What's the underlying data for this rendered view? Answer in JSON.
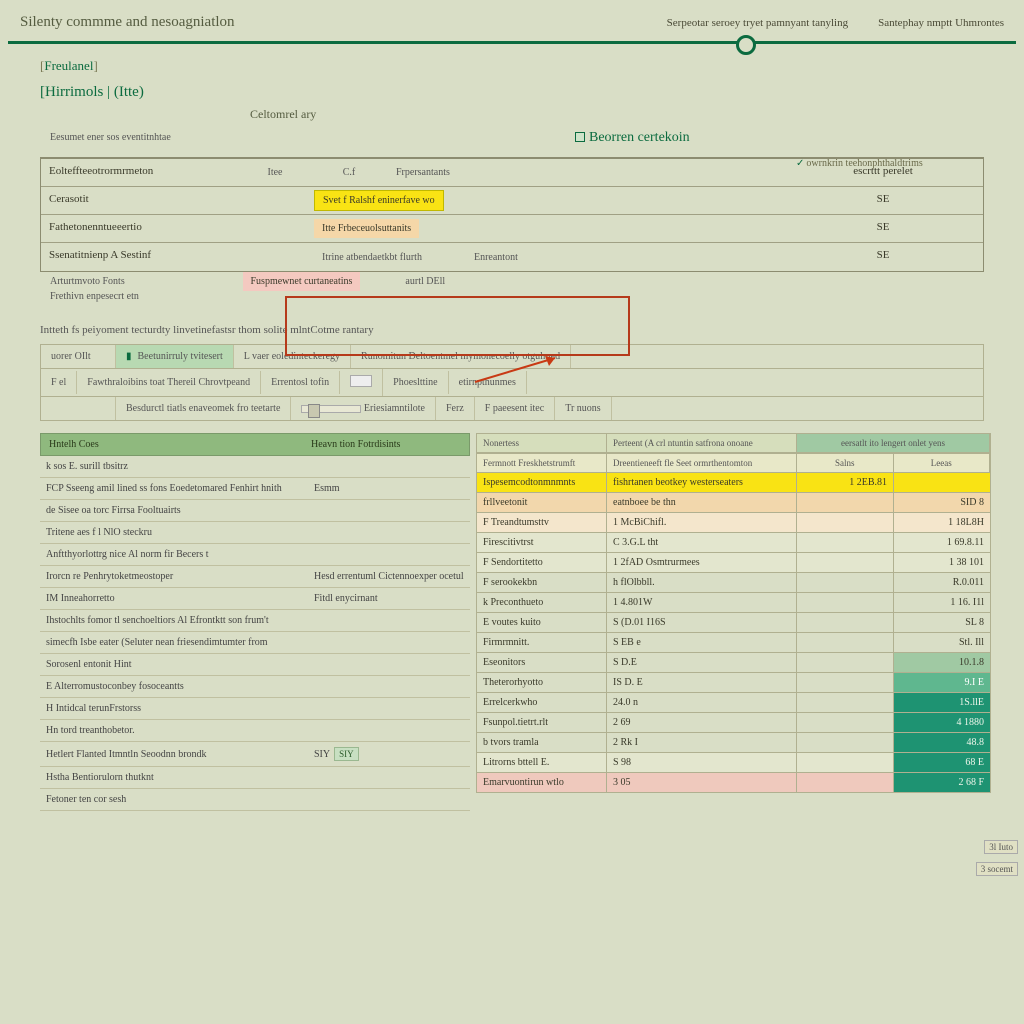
{
  "header": {
    "title": "Silenty commme and nesoagniatlon",
    "right1": "Serpeotar seroey tryet pamnyant tanyling",
    "right2": "Santephay nmptt Uhmrontes"
  },
  "crumbs": {
    "featured": "Freulanel",
    "controls": "Hirrimols | (Itte)",
    "section": "Beorren certekoin",
    "caption": "Celtomrel ary",
    "sidenote": "owrnkrin teehonphthaldtrims"
  },
  "pre_line": "Eesumet ener sos eventitnhtae",
  "summary": {
    "headers": {
      "c1": "Eolteffteeotrormrmeton",
      "mid": "Frpersantants",
      "c3": "escrttt perelet"
    },
    "rows": [
      {
        "c1": "Cerasotit",
        "chip": "Svet f Ralshf eninerfave wo",
        "chip_cls": "yellow-chip",
        "suffix": "",
        "c3": "SE"
      },
      {
        "c1": "Fathetonenntueeertio",
        "chip": "Itte Frbeceuolsuttanits",
        "chip_cls": "peach-chip",
        "suffix": "",
        "c3": "SE"
      },
      {
        "c1": "Ssenatitnienp  A Sestinf",
        "chip": "Itrine atbendaetkbt  flurth",
        "chip_cls": "plain-chip",
        "suffix": "Enreantont",
        "c3": "SE"
      }
    ],
    "after1": {
      "label": "Arturtmvoto Fonts",
      "chip": "Fuspmewnet curtaneatins",
      "chip_cls": "pink-chip",
      "suffix": "aurtl DEll"
    },
    "after2": "Frethivn enpesecrt etn"
  },
  "desc": "Intteth fs peiyoment tecturdty linvetinefastsr thom solite mlntCotme rantary",
  "filters": {
    "row1": [
      {
        "label": "uorer OIlt"
      },
      {
        "label": "Beetunirruly tvitesert",
        "green": true,
        "tick": true
      },
      {
        "label": "L vaer eoledinteckeregy"
      },
      {
        "label": "Runomitun Deltoentmel mymonecoelly otgulmed"
      }
    ],
    "row2": [
      {
        "label": "F el"
      },
      {
        "label": "Fawthraloibins toat Thereil Chrovtpeand"
      },
      {
        "label": "Errentosl tofin"
      },
      {
        "label": "",
        "swatch": true
      },
      {
        "label": "Phoeslttine"
      },
      {
        "label": "etirnpthunmes"
      }
    ],
    "row3": [
      {
        "label": " "
      },
      {
        "label": "Besdurctl tiatls enaveomek  fro teetarte"
      },
      {
        "label": "Eriesiamntilote",
        "slider": true
      },
      {
        "label": "Ferz"
      },
      {
        "label": "F paeesent itec"
      },
      {
        "label": "Tr nuons"
      }
    ]
  },
  "left": {
    "header": {
      "a": "Hntelh Coes",
      "b": "Heavn tion Fotrdisints"
    },
    "rows": [
      {
        "a": "k sos E. surill  tbsitrz",
        "b": ""
      },
      {
        "a": "FCP Sseeng amil lined ss fons  Eoedetomared  Fenhirt hnith",
        "b": "Esmm"
      },
      {
        "a": "de Sisee oa torc Firrsa Fooltuairts",
        "b": ""
      },
      {
        "a": "Tritene  aes f l NlO steckru",
        "b": ""
      },
      {
        "a": "Anftthyorlottrg nice Al norm fir Becers t",
        "b": ""
      },
      {
        "a": "Irorcn re Penhrytoketmeostoper",
        "b": "Hesd errentuml Cictennoexper ocetul"
      },
      {
        "a": "IM Inneahorretto",
        "b": "Fitdl enycirnant"
      },
      {
        "a": "Ihstochlts fomor tl senchoeltiors Al  Efrontktt son frum't",
        "b": ""
      },
      {
        "a": "simecfh Isbe eater (Seluter nean friesendimtumter from",
        "b": ""
      },
      {
        "a": "Sorosenl entonit Hint",
        "b": ""
      },
      {
        "a": "E Alterromustoconbey fosoceantts",
        "b": ""
      },
      {
        "a": "H Intidcal terunFrstorss",
        "b": ""
      },
      {
        "a": "Hn tord treanthobetor.",
        "b": ""
      },
      {
        "a": "Hetlert Flanted Itmntln Seoodnn brondk",
        "b": "SIY",
        "badge": true
      },
      {
        "a": "Hstha Bentiorulorn thutknt",
        "b": ""
      },
      {
        "a": "Fetoner ten cor sesh",
        "b": ""
      }
    ]
  },
  "right": {
    "topband": {
      "b1": "Nonertess",
      "b2": "Perteent (A crl ntuntin satfrona onoane",
      "g": "eersatlt ito lengert onlet yens",
      "s1": "Salns",
      "s2": "Leeas"
    },
    "head2": {
      "b1": "Fermnott Freskhetstrumft",
      "b2": "Dreentieneeft fle Seet ormrthentomton"
    },
    "rows": [
      {
        "c1": "Ispesemcodtonmnmnts",
        "c2": "fishrtanen beotkey westerseaters",
        "c3": "1  2EB.81",
        "c4": "",
        "cls": "yellow"
      },
      {
        "c1": "frllveetonit",
        "c2": "eatnboee be thn",
        "c3": "",
        "c4": "SID 8",
        "cls": "peach"
      },
      {
        "c1": "F Treandtumsttv",
        "c2": "1  McBiChifl.",
        "c3": "",
        "c4": "1  18L8H",
        "cls": "lpeach"
      },
      {
        "c1": "Firescitivtrst",
        "c2": "C 3.G.L tht",
        "c3": "",
        "c4": "1 69.8.11",
        "cls": "plain2"
      },
      {
        "c1": "F Sendortitetto",
        "c2": "1 2fAD Osmtrurmees",
        "c3": "",
        "c4": "1  38 101",
        "cls": "plain2"
      },
      {
        "c1": "F serookekbn",
        "c2": "h  flOlbbll.",
        "c3": "",
        "c4": "R.0.011",
        "cls": "plain"
      },
      {
        "c1": "k Preconthueto",
        "c2": "1 4.801W",
        "c3": "",
        "c4": "1 16. I1l",
        "cls": "plain",
        "side": "3l Iuto"
      },
      {
        "c1": "E voutes kuito",
        "c2": "S (D.01 I16S",
        "c3": "",
        "c4": "SL 8",
        "cls": "plain",
        "side": "3 socemt"
      },
      {
        "c1": "Firmrmnitt.",
        "c2": "S EB e",
        "c3": "",
        "c4": "Stl. Ill",
        "cls": "plain"
      },
      {
        "c1": "Eseonitors",
        "c2": "S D.E",
        "c3": "",
        "c4": "10.1.8",
        "cls": "plain",
        "c4cls": "green"
      },
      {
        "c1": "Theterorhyotto",
        "c2": "IS D. E",
        "c3": "",
        "c4": "9.I E",
        "cls": "plain",
        "c4cls": "tealL"
      },
      {
        "c1": "Errelcerkwho",
        "c2": "24.0 n",
        "c3": "",
        "c4": "1S.llE",
        "cls": "plain",
        "c4cls": "teal"
      },
      {
        "c1": "Fsunpol.tietrt.rlt",
        "c2": "2 69",
        "c3": "",
        "c4": "4 1880",
        "cls": "plain",
        "c4cls": "teal"
      },
      {
        "c1": "b tvors tramla",
        "c2": "2 Rk I",
        "c3": "",
        "c4": "48.8",
        "cls": "plain",
        "c4cls": "teal"
      },
      {
        "c1": "Litrorns bttell E.",
        "c2": "S 98",
        "c3": "",
        "c4": "68 E",
        "cls": "plain2",
        "c4cls": "teal"
      },
      {
        "c1": "Emarvuontirun wtlo",
        "c2": "3 05",
        "c3": "",
        "c4": "2 68 F",
        "cls": "pink",
        "c4cls": "teal"
      }
    ]
  },
  "stickers": {
    "a": "3l Iuto",
    "b": "3  socemt"
  }
}
